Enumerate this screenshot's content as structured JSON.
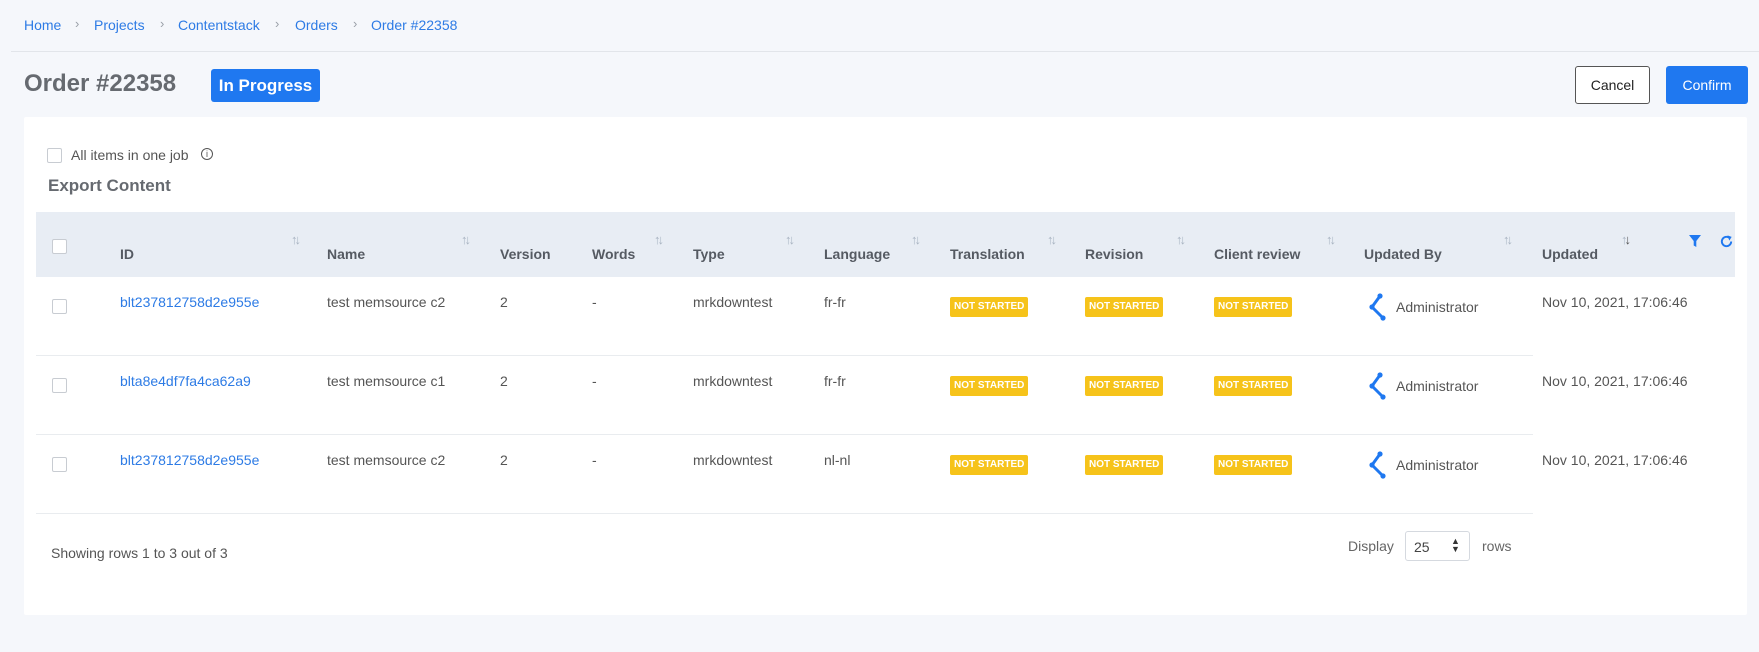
{
  "breadcrumb": {
    "items": [
      "Home",
      "Projects",
      "Contentstack",
      "Orders",
      "Order #22358"
    ]
  },
  "header": {
    "title": "Order #22358",
    "status": "In Progress",
    "cancel_label": "Cancel",
    "confirm_label": "Confirm"
  },
  "options": {
    "all_items_label": "All items in one job",
    "all_items_checked": false
  },
  "section": {
    "title": "Export Content"
  },
  "table": {
    "columns": [
      "ID",
      "Name",
      "Version",
      "Words",
      "Type",
      "Language",
      "Translation",
      "Revision",
      "Client review",
      "Updated By",
      "Updated"
    ],
    "rows": [
      {
        "id": "blt237812758d2e955e",
        "name": "test memsource c2",
        "version": "2",
        "words": "-",
        "type": "mrkdowntest",
        "language": "fr-fr",
        "translation": "NOT STARTED",
        "revision": "NOT STARTED",
        "client_review": "NOT STARTED",
        "updated_by": "Administrator",
        "updated": "Nov 10, 2021, 17:06:46"
      },
      {
        "id": "blta8e4df7fa4ca62a9",
        "name": "test memsource c1",
        "version": "2",
        "words": "-",
        "type": "mrkdowntest",
        "language": "fr-fr",
        "translation": "NOT STARTED",
        "revision": "NOT STARTED",
        "client_review": "NOT STARTED",
        "updated_by": "Administrator",
        "updated": "Nov 10, 2021, 17:06:46"
      },
      {
        "id": "blt237812758d2e955e",
        "name": "test memsource c2",
        "version": "2",
        "words": "-",
        "type": "mrkdowntest",
        "language": "nl-nl",
        "translation": "NOT STARTED",
        "revision": "NOT STARTED",
        "client_review": "NOT STARTED",
        "updated_by": "Administrator",
        "updated": "Nov 10, 2021, 17:06:46"
      }
    ]
  },
  "footer": {
    "showing": "Showing rows 1 to 3 out of 3",
    "display_label": "Display",
    "rows_per_page": "25",
    "rows_label": "rows"
  },
  "colors": {
    "accent": "#1f78f0",
    "status_not_started": "#f6c31a",
    "link": "#2d7be5"
  },
  "icons": [
    "chevron-right-icon",
    "info-icon",
    "sort-icon",
    "filter-icon",
    "refresh-icon",
    "admin-avatar-icon",
    "select-arrows-icon"
  ]
}
